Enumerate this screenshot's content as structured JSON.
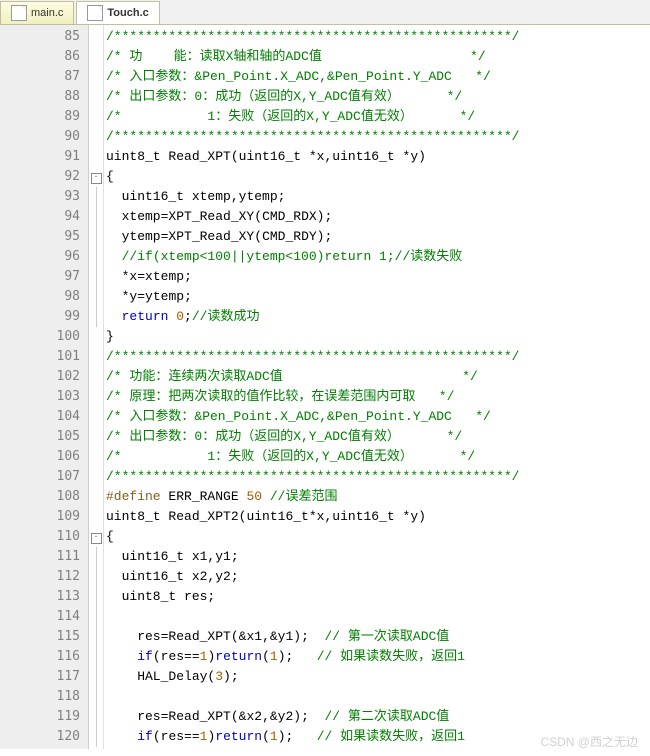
{
  "tabs": [
    {
      "label": "main.c",
      "active": false
    },
    {
      "label": "Touch.c",
      "active": true
    }
  ],
  "first_line_number": 85,
  "last_line_number": 120,
  "code_tokens": [
    [
      {
        "t": "/***************************************************/",
        "c": "cm"
      }
    ],
    [
      {
        "t": "/* 功    能：读取X轴和轴的ADC值                   */",
        "c": "cm"
      }
    ],
    [
      {
        "t": "/* 入口参数：&Pen_Point.X_ADC,&Pen_Point.Y_ADC   */",
        "c": "cm"
      }
    ],
    [
      {
        "t": "/* 出口参数：0：成功（返回的X,Y_ADC值有效）      */",
        "c": "cm"
      }
    ],
    [
      {
        "t": "/*           1：失败（返回的X,Y_ADC值无效）      */",
        "c": "cm"
      }
    ],
    [
      {
        "t": "/***************************************************/",
        "c": "cm"
      }
    ],
    [
      {
        "t": "uint8_t Read_XPT",
        "c": ""
      },
      {
        "t": "(",
        "c": ""
      },
      {
        "t": "uint16_t ",
        "c": ""
      },
      {
        "t": "*",
        "c": ""
      },
      {
        "t": "x",
        "c": ""
      },
      {
        "t": ",",
        "c": ""
      },
      {
        "t": "uint16_t ",
        "c": ""
      },
      {
        "t": "*",
        "c": ""
      },
      {
        "t": "y",
        "c": ""
      },
      {
        "t": ")",
        "c": ""
      }
    ],
    [
      {
        "t": "{",
        "c": ""
      }
    ],
    [
      {
        "t": "  uint16_t xtemp",
        "c": ""
      },
      {
        "t": ",",
        "c": ""
      },
      {
        "t": "ytemp",
        "c": ""
      },
      {
        "t": ";",
        "c": ""
      }
    ],
    [
      {
        "t": "  xtemp",
        "c": ""
      },
      {
        "t": "=",
        "c": ""
      },
      {
        "t": "XPT_Read_XY",
        "c": ""
      },
      {
        "t": "(",
        "c": ""
      },
      {
        "t": "CMD_RDX",
        "c": ""
      },
      {
        "t": ");",
        "c": ""
      }
    ],
    [
      {
        "t": "  ytemp",
        "c": ""
      },
      {
        "t": "=",
        "c": ""
      },
      {
        "t": "XPT_Read_XY",
        "c": ""
      },
      {
        "t": "(",
        "c": ""
      },
      {
        "t": "CMD_RDY",
        "c": ""
      },
      {
        "t": ");",
        "c": ""
      }
    ],
    [
      {
        "t": "  ",
        "c": ""
      },
      {
        "t": "//if(xtemp<100||ytemp<100)return 1;//读数失败",
        "c": "cm"
      }
    ],
    [
      {
        "t": "  ",
        "c": ""
      },
      {
        "t": "*",
        "c": ""
      },
      {
        "t": "x",
        "c": ""
      },
      {
        "t": "=",
        "c": ""
      },
      {
        "t": "xtemp",
        "c": ""
      },
      {
        "t": ";",
        "c": ""
      }
    ],
    [
      {
        "t": "  ",
        "c": ""
      },
      {
        "t": "*",
        "c": ""
      },
      {
        "t": "y",
        "c": ""
      },
      {
        "t": "=",
        "c": ""
      },
      {
        "t": "ytemp",
        "c": ""
      },
      {
        "t": ";",
        "c": ""
      }
    ],
    [
      {
        "t": "  ",
        "c": ""
      },
      {
        "t": "return",
        "c": "kw"
      },
      {
        "t": " ",
        "c": ""
      },
      {
        "t": "0",
        "c": "nm"
      },
      {
        "t": ";",
        "c": ""
      },
      {
        "t": "//读数成功",
        "c": "cm"
      }
    ],
    [
      {
        "t": "}",
        "c": ""
      }
    ],
    [
      {
        "t": "/***************************************************/",
        "c": "cm"
      }
    ],
    [
      {
        "t": "/* 功能：连续两次读取ADC值                       */",
        "c": "cm"
      }
    ],
    [
      {
        "t": "/* 原理：把两次读取的值作比较，在误差范围内可取   */",
        "c": "cm"
      }
    ],
    [
      {
        "t": "/* 入口参数：&Pen_Point.X_ADC,&Pen_Point.Y_ADC   */",
        "c": "cm"
      }
    ],
    [
      {
        "t": "/* 出口参数：0：成功（返回的X,Y_ADC值有效）      */",
        "c": "cm"
      }
    ],
    [
      {
        "t": "/*           1：失败（返回的X,Y_ADC值无效）      */",
        "c": "cm"
      }
    ],
    [
      {
        "t": "/***************************************************/",
        "c": "cm"
      }
    ],
    [
      {
        "t": "#define",
        "c": "pp"
      },
      {
        "t": " ERR_RANGE ",
        "c": ""
      },
      {
        "t": "50",
        "c": "nm"
      },
      {
        "t": " ",
        "c": ""
      },
      {
        "t": "//误差范围",
        "c": "cm"
      }
    ],
    [
      {
        "t": "uint8_t Read_XPT2",
        "c": ""
      },
      {
        "t": "(",
        "c": ""
      },
      {
        "t": "uint16_t",
        "c": ""
      },
      {
        "t": "*",
        "c": ""
      },
      {
        "t": "x",
        "c": ""
      },
      {
        "t": ",",
        "c": ""
      },
      {
        "t": "uint16_t ",
        "c": ""
      },
      {
        "t": "*",
        "c": ""
      },
      {
        "t": "y",
        "c": ""
      },
      {
        "t": ")",
        "c": ""
      }
    ],
    [
      {
        "t": "{",
        "c": ""
      }
    ],
    [
      {
        "t": "  uint16_t x1",
        "c": ""
      },
      {
        "t": ",",
        "c": ""
      },
      {
        "t": "y1",
        "c": ""
      },
      {
        "t": ";",
        "c": ""
      }
    ],
    [
      {
        "t": "  uint16_t x2",
        "c": ""
      },
      {
        "t": ",",
        "c": ""
      },
      {
        "t": "y2",
        "c": ""
      },
      {
        "t": ";",
        "c": ""
      }
    ],
    [
      {
        "t": "  uint8_t res",
        "c": ""
      },
      {
        "t": ";",
        "c": ""
      }
    ],
    [],
    [
      {
        "t": "    res",
        "c": ""
      },
      {
        "t": "=",
        "c": ""
      },
      {
        "t": "Read_XPT",
        "c": ""
      },
      {
        "t": "(&",
        "c": ""
      },
      {
        "t": "x1",
        "c": ""
      },
      {
        "t": ",&",
        "c": ""
      },
      {
        "t": "y1",
        "c": ""
      },
      {
        "t": ");  ",
        "c": ""
      },
      {
        "t": "// 第一次读取ADC值",
        "c": "cm"
      }
    ],
    [
      {
        "t": "    ",
        "c": ""
      },
      {
        "t": "if",
        "c": "kw"
      },
      {
        "t": "(",
        "c": ""
      },
      {
        "t": "res",
        "c": ""
      },
      {
        "t": "==",
        "c": ""
      },
      {
        "t": "1",
        "c": "nm"
      },
      {
        "t": ")",
        "c": ""
      },
      {
        "t": "return",
        "c": "kw"
      },
      {
        "t": "(",
        "c": ""
      },
      {
        "t": "1",
        "c": "nm"
      },
      {
        "t": ");   ",
        "c": ""
      },
      {
        "t": "// 如果读数失败，返回1",
        "c": "cm"
      }
    ],
    [
      {
        "t": "    HAL_Delay",
        "c": ""
      },
      {
        "t": "(",
        "c": ""
      },
      {
        "t": "3",
        "c": "nm"
      },
      {
        "t": ");",
        "c": ""
      }
    ],
    [],
    [
      {
        "t": "    res",
        "c": ""
      },
      {
        "t": "=",
        "c": ""
      },
      {
        "t": "Read_XPT",
        "c": ""
      },
      {
        "t": "(&",
        "c": ""
      },
      {
        "t": "x2",
        "c": ""
      },
      {
        "t": ",&",
        "c": ""
      },
      {
        "t": "y2",
        "c": ""
      },
      {
        "t": ");  ",
        "c": ""
      },
      {
        "t": "// 第二次读取ADC值",
        "c": "cm"
      }
    ],
    [
      {
        "t": "    ",
        "c": ""
      },
      {
        "t": "if",
        "c": "kw"
      },
      {
        "t": "(",
        "c": ""
      },
      {
        "t": "res",
        "c": ""
      },
      {
        "t": "==",
        "c": ""
      },
      {
        "t": "1",
        "c": "nm"
      },
      {
        "t": ")",
        "c": ""
      },
      {
        "t": "return",
        "c": "kw"
      },
      {
        "t": "(",
        "c": ""
      },
      {
        "t": "1",
        "c": "nm"
      },
      {
        "t": ");   ",
        "c": ""
      },
      {
        "t": "// 如果读数失败，返回1",
        "c": "cm"
      }
    ]
  ],
  "fold_markers": {
    "92": "box",
    "110": "box"
  },
  "watermark": "CSDN @西之无边"
}
